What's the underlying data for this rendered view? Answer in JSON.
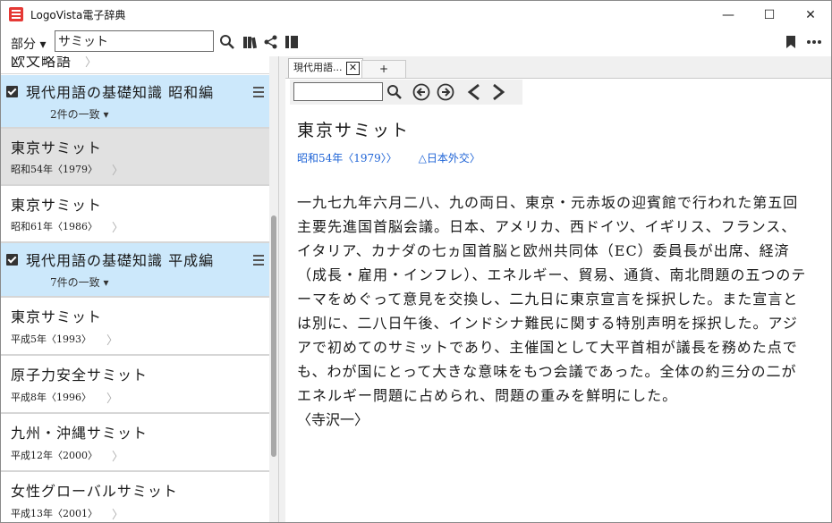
{
  "window": {
    "title": "LogoVista電子辞典",
    "minimize": "—",
    "maximize": "☐",
    "close": "✕"
  },
  "toolbar": {
    "scope_label": "部分 ▾",
    "search_value": "サミット",
    "icons": [
      "search-icon",
      "library-icon",
      "share-icon",
      "panel-toggle-icon",
      "bookmark-icon",
      "more-icon"
    ]
  },
  "list": {
    "top_clipped_text": "欧文略語",
    "groups": [
      {
        "title": "現代用語の基礎知識 昭和編",
        "count": "2件の一致",
        "items": [
          {
            "title": "東京サミット",
            "sub": "昭和54年〈1979〉",
            "selected": true
          },
          {
            "title": "東京サミット",
            "sub": "昭和61年〈1986〉",
            "selected": false
          }
        ]
      },
      {
        "title": "現代用語の基礎知識 平成編",
        "count": "7件の一致",
        "items": [
          {
            "title": "東京サミット",
            "sub": "平成5年〈1993〉",
            "selected": false
          },
          {
            "title": "原子力安全サミット",
            "sub": "平成8年〈1996〉",
            "selected": false
          },
          {
            "title": "九州・沖縄サミット",
            "sub": "平成12年〈2000〉",
            "selected": false
          },
          {
            "title": "女性グローバルサミット",
            "sub": "平成13年〈2001〉",
            "selected": false
          }
        ]
      }
    ],
    "chevron": "〉"
  },
  "tabs": {
    "active_label": "現代用語...",
    "close_label": "✕",
    "add_label": "+"
  },
  "article": {
    "headword": "東京サミット",
    "meta_year": "昭和54年〈1979〉〉",
    "meta_category": "△日本外交〉",
    "body": "一九七九年六月二八、九の両日、東京・元赤坂の迎賓館で行われた第五回主要先進国首脳会議。日本、アメリカ、西ドイツ、イギリス、フランス、イタリア、カナダの七ヵ国首脳と欧州共同体（EC）委員長が出席、経済（成長・雇用・インフレ）、エネルギー、貿易、通貨、南北問題の五つのテーマをめぐって意見を交換し、二九日に東京宣言を採択した。また宣言とは別に、二八日午後、インドシナ難民に関する特別声明を採択した。アジアで初めてのサミットであり、主催国として大平首相が議長を務めた点でも、わが国にとって大きな意味をもつ会議であった。全体の約三分の二がエネルギー問題に占められ、問題の重みを鮮明にした。",
    "author": "〈寺沢一〉"
  }
}
